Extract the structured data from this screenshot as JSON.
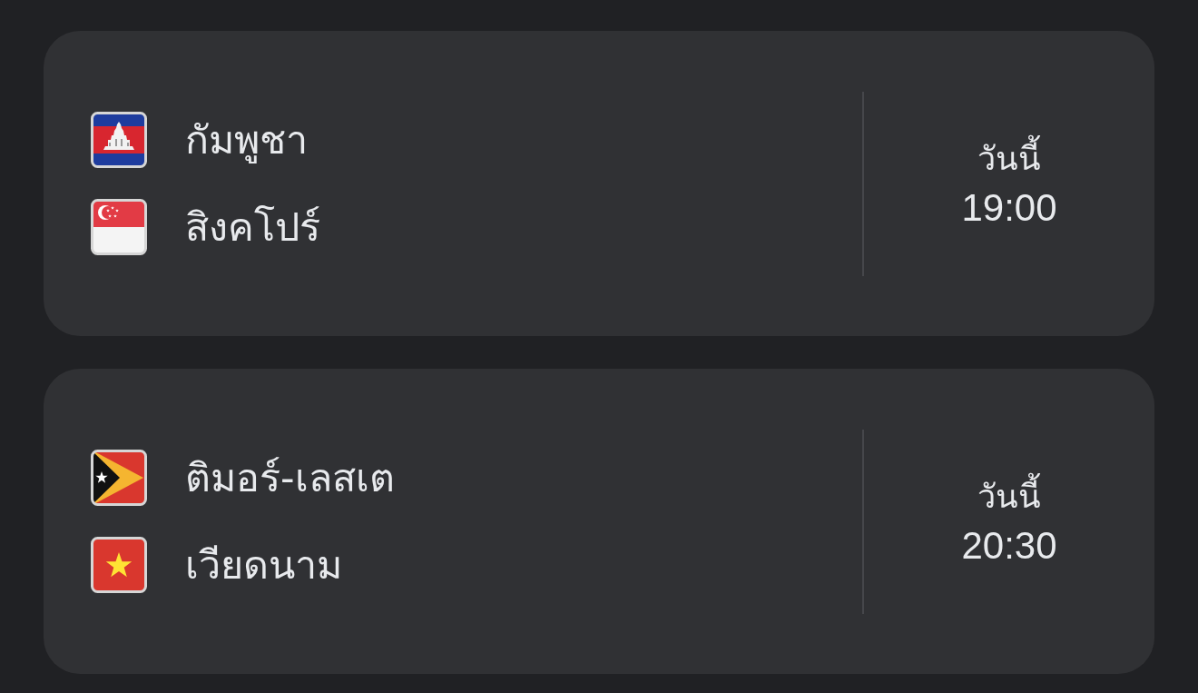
{
  "matches": [
    {
      "teams": [
        {
          "name": "กัมพูชา",
          "kind": "cambodia"
        },
        {
          "name": "สิงคโปร์",
          "kind": "singapore"
        }
      ],
      "day": "วันนี้",
      "time": "19:00"
    },
    {
      "teams": [
        {
          "name": "ติมอร์-เลสเต",
          "kind": "timor"
        },
        {
          "name": "เวียดนาม",
          "kind": "vietnam"
        }
      ],
      "day": "วันนี้",
      "time": "20:30"
    }
  ]
}
